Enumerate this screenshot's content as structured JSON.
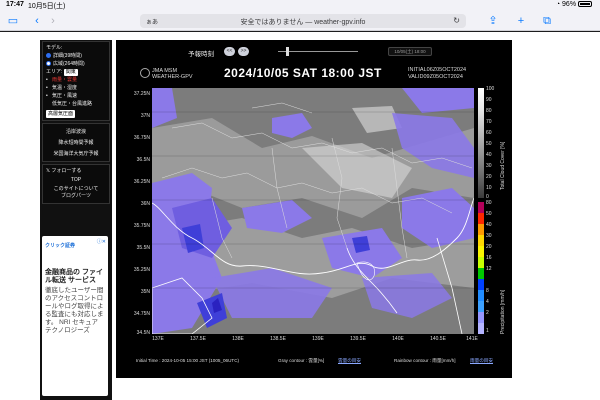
{
  "status_bar": {
    "time": "17:47",
    "date": "10月5日(土)",
    "battery": "96%"
  },
  "browser": {
    "aa": "ぁあ",
    "url_text": "安全ではありません — weather-gpv.info"
  },
  "sidebar": {
    "model_label": "モデル:",
    "models": [
      {
        "label": "詳細(39時間)",
        "selected": true
      },
      {
        "label": "広域(264時間)",
        "selected": false
      }
    ],
    "area_label": "エリア:",
    "area_value": "関東",
    "layers": [
      {
        "label": "雨量・雲量",
        "active": true
      },
      {
        "label": "気温・湿度",
        "active": false
      },
      {
        "label": "気圧・風速",
        "active": false
      },
      {
        "label": "低気圧・台風進路",
        "active": false
      }
    ],
    "pressure_button": "高層気圧面",
    "extra_links": [
      "沿岸波浪",
      "降水短時間予報",
      "米国海洋大気庁予報"
    ],
    "follow_button": "フォローする",
    "top_link": "TOP",
    "about_link": "このサイトについて",
    "parts_link": "ブログパーツ"
  },
  "ad": {
    "logo": "クリック証券",
    "headline": "金融商品の ファイル転送 サービス",
    "body": "徹底したユーザー間のアクセスコントロールやログ取得による監査にも対応します。 NRI セキュア テクノロジーズ"
  },
  "controls": {
    "forecast_time_label": "予報時刻",
    "prev": "<<",
    "next": ">>",
    "date_select": "10/05(土) 18:00"
  },
  "header": {
    "source_line1": "JMA MSM",
    "source_line2": "WEATHER-GPV",
    "title": "2024/10/05 SAT 18:00 JST",
    "initial": "INITIAL06Z05OCT2024",
    "valid": "VALID09Z05OCT2024"
  },
  "axes": {
    "y_ticks": [
      "37.25N",
      "37N",
      "36.75N",
      "36.5N",
      "36.25N",
      "36N",
      "35.75N",
      "35.5N",
      "35.25N",
      "35N",
      "34.75N",
      "34.5N"
    ],
    "x_ticks": [
      "137E",
      "137.5E",
      "138E",
      "138.5E",
      "139E",
      "139.5E",
      "140E",
      "140.5E",
      "141E"
    ]
  },
  "legend_cloud": {
    "title": "Total Cloud Cover [%]",
    "labels": [
      "100",
      "90",
      "80",
      "70",
      "60",
      "50",
      "40",
      "30",
      "20",
      "10",
      "0"
    ]
  },
  "legend_rain": {
    "title": "Precipitation [mm/h]",
    "labels": [
      "80",
      "50",
      "40",
      "30",
      "20",
      "16",
      "12",
      "8",
      "4",
      "2",
      "1"
    ],
    "colors": [
      "#b4005a",
      "#ff2800",
      "#ff9900",
      "#ffd700",
      "#faf500",
      "#c8ff00",
      "#00c800",
      "#0041ff",
      "#218cff",
      "#3ca0ff",
      "#9696ff",
      "#b4b4ff"
    ]
  },
  "footer": {
    "initial_time": "Initial Time : 2024-10-05 15:00 JST (1005_06UTC)",
    "gray_contour": "Gray contour : 雲量[%]",
    "gray_link": "雲量の目安",
    "rainbow_contour": "Rainbow contour : 雨量[mm/h]",
    "rainbow_link": "雨量の目安"
  }
}
